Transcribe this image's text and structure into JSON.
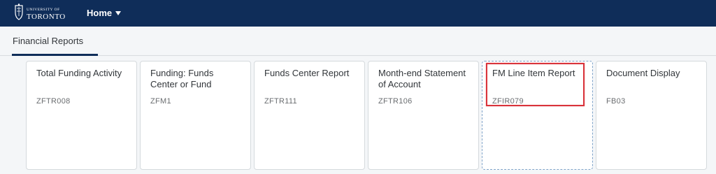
{
  "header": {
    "logo_small": "UNIVERSITY OF",
    "logo_big": "TORONTO",
    "home_label": "Home"
  },
  "tabs": [
    {
      "label": "Financial Reports",
      "selected": true
    }
  ],
  "tiles": [
    {
      "title": "Total Funding Activ­ity",
      "subtitle": "ZFTR008"
    },
    {
      "title": "Funding: Funds Center or Fund",
      "subtitle": "ZFM1"
    },
    {
      "title": "Funds Center Report",
      "subtitle": "ZFTR111"
    },
    {
      "title": "Month-end State­ment of Account",
      "subtitle": "ZFTR106"
    },
    {
      "title": "FM Line Item Report",
      "subtitle": "ZFIR079",
      "focused": true,
      "highlighted": true
    },
    {
      "title": "Document Display",
      "subtitle": "FB03"
    }
  ],
  "colors": {
    "header_bg": "#0f2d59",
    "highlight": "#d9333b"
  }
}
